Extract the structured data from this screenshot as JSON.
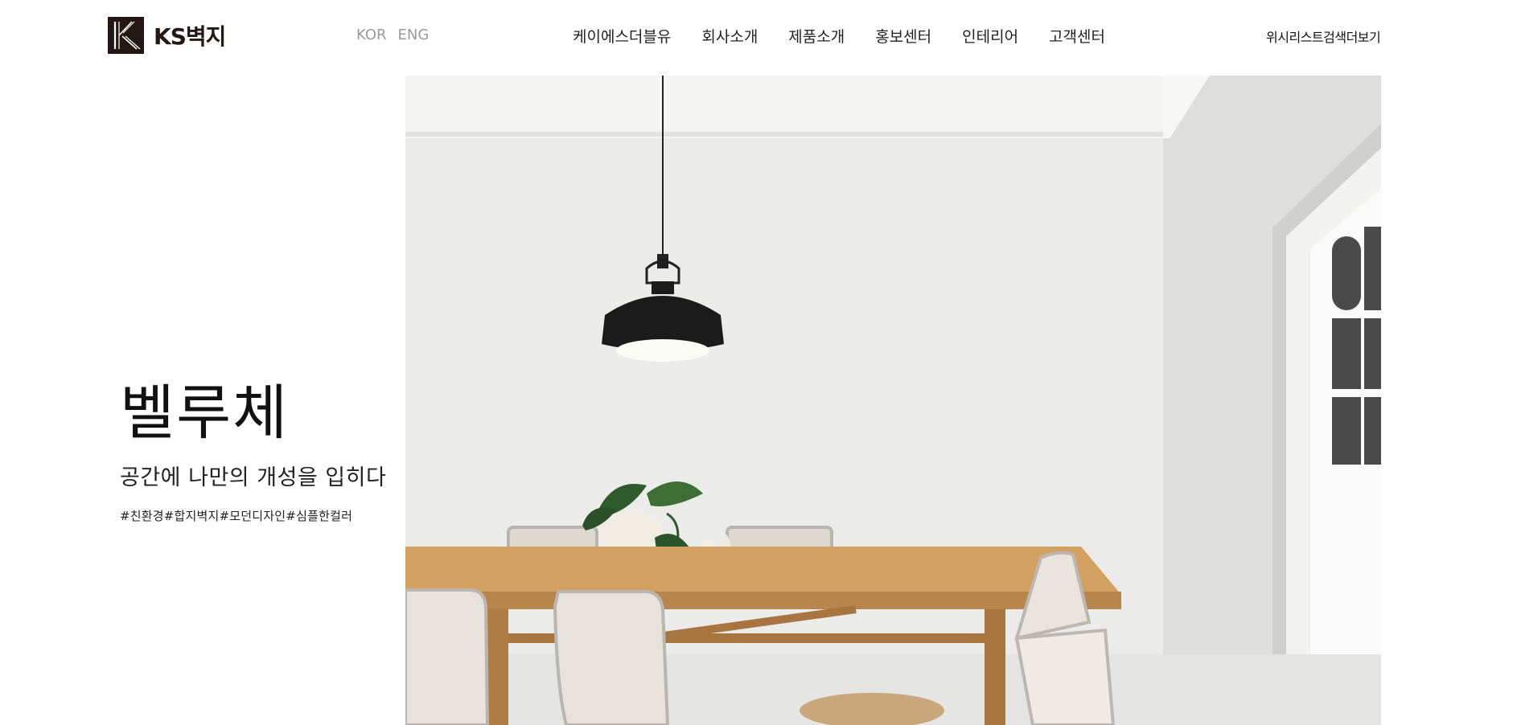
{
  "brand": {
    "name": "KS벽지"
  },
  "lang": {
    "kor": "KOR",
    "eng": "ENG"
  },
  "gnb": [
    {
      "label": "케이에스더블유"
    },
    {
      "label": "회사소개"
    },
    {
      "label": "제품소개"
    },
    {
      "label": "홍보센터"
    },
    {
      "label": "인테리어"
    },
    {
      "label": "고객센터"
    }
  ],
  "util": {
    "wishlist": "위시리스트",
    "search": "검색",
    "more": "더보기"
  },
  "hero": {
    "title": "벨루체",
    "subtitle": "공간에 나만의 개성을 입히다",
    "tags": "#친환경#합지벽지#모던디자인#심플한컬러"
  },
  "colors": {
    "accent": "#231815",
    "lang_muted": "#9a9a9a",
    "wall": "#ececec",
    "table_wood": "#d2a161"
  }
}
